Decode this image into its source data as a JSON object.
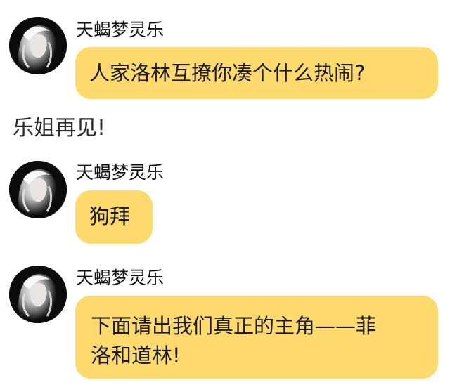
{
  "colors": {
    "bubble": "#fed96b",
    "background": "#ffffff",
    "text": "#222222"
  },
  "messages": [
    {
      "sender": "天蝎梦灵乐",
      "avatar_icon": "white-haired-girl-avatar",
      "text": "人家洛林互撩你凑个什么热闹?"
    },
    {
      "sender": "天蝎梦灵乐",
      "avatar_icon": "white-haired-girl-avatar",
      "text": "狗拜"
    },
    {
      "sender": "天蝎梦灵乐",
      "avatar_icon": "white-haired-girl-avatar",
      "lines": [
        "下面请出我们真正的主角——菲",
        "洛和道林!"
      ]
    }
  ],
  "narration": "乐姐再见!"
}
